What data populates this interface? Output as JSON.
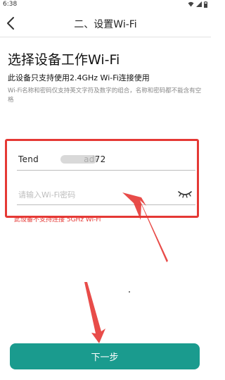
{
  "status_bar": {
    "time": "6:38"
  },
  "header": {
    "title": "二、设置Wi-Fi"
  },
  "main": {
    "heading": "选择设备工作Wi-Fi",
    "subheading": "此设备只支持使用2.4GHz Wi-Fi连接使用",
    "note": "Wi-Fi名称和密码仅支持英文字符及数字的组合，名称和密码都不能含有空格"
  },
  "form": {
    "ssid_prefix": "Tend",
    "ssid_suffix": "ad72",
    "password_placeholder": "请输入Wi-Fi密码",
    "warning": "此设备不支持连接 5GHz Wi-Fi"
  },
  "footer": {
    "next_label": "下一步"
  },
  "colors": {
    "accent": "#1a9b8e",
    "annotation": "#e53935"
  }
}
